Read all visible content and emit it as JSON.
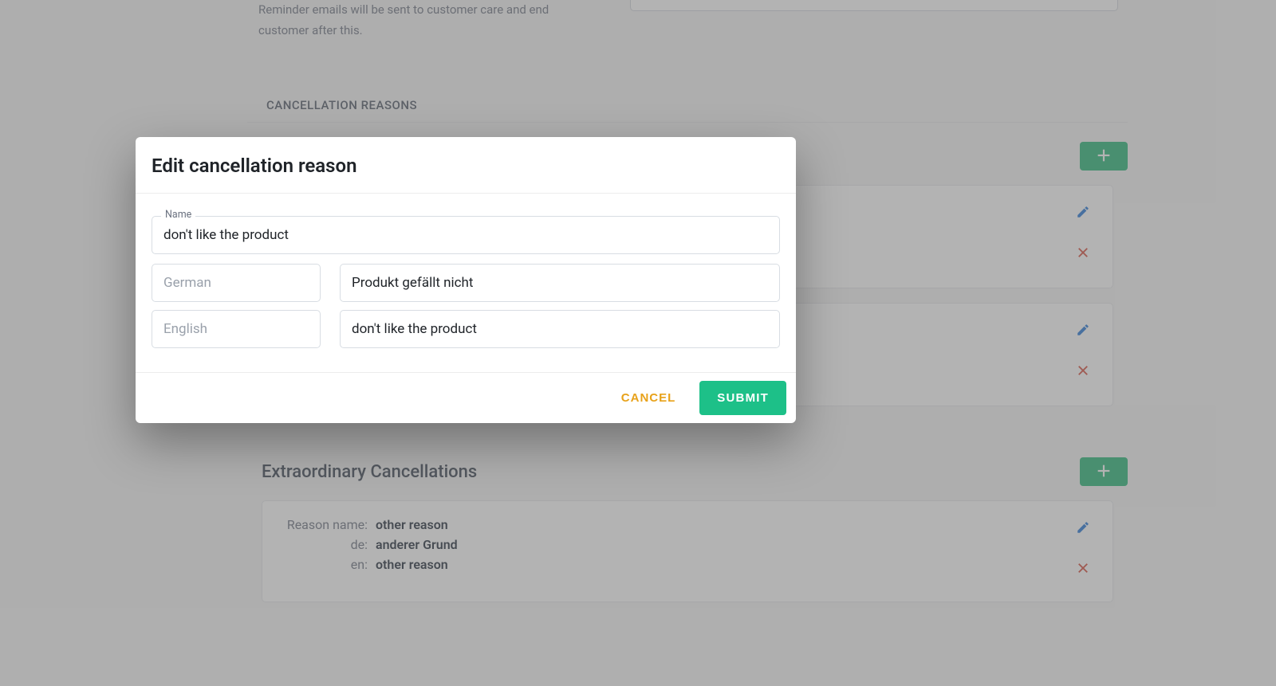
{
  "top_area": {
    "description_line1": "Reminder emails will be sent to customer care and end",
    "description_line2": "customer after this."
  },
  "section_header": "CANCELLATION REASONS",
  "ordinary_section_visible_title": "",
  "cards": [
    {},
    {}
  ],
  "extraordinary_section": {
    "title": "Extraordinary Cancellations",
    "card": {
      "reason_label": "Reason name:",
      "reason_value": "other reason",
      "de_label": "de:",
      "de_value": "anderer Grund",
      "en_label": "en:",
      "en_value": "other reason"
    }
  },
  "dialog": {
    "title": "Edit cancellation reason",
    "name_label": "Name",
    "name_value": "don't like the product",
    "rows": [
      {
        "lang_placeholder": "German",
        "value": "Produkt gefällt nicht"
      },
      {
        "lang_placeholder": "English",
        "value": "don't like the product"
      }
    ],
    "cancel": "CANCEL",
    "submit": "SUBMIT"
  },
  "colors": {
    "accent_green": "#1dc088",
    "add_green": "#22b573",
    "warn_gold": "#e8a21a",
    "edit_blue": "#2173d6",
    "delete_red": "#d64535"
  }
}
